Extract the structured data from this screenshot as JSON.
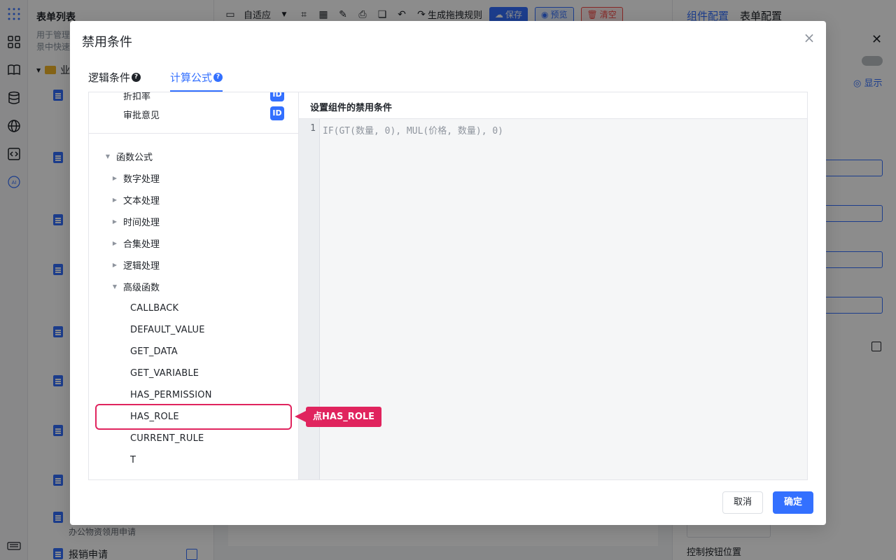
{
  "background": {
    "list_title": "表单列表",
    "list_desc_1": "用于管理",
    "list_desc_2": "景中快速",
    "folder_label": "业",
    "bottom_sub": "办公物资领用申请",
    "bottom_item": "报销申请",
    "toolbar": {
      "adapt_label": "自适应",
      "gen_rule_label": "生成拖拽规则",
      "save_label": "保存",
      "preview_label": "预览",
      "clear_label": "清空"
    },
    "right": {
      "tab_component": "组件配置",
      "tab_form": "表单配置",
      "show_label": "显示",
      "bottom_label": "控制按钮位置"
    }
  },
  "modal": {
    "title": "禁用条件",
    "tabs": [
      {
        "label": "逻辑条件",
        "active": false
      },
      {
        "label": "计算公式",
        "active": true
      }
    ],
    "fields": [
      {
        "label": "折扣率",
        "badge": "ID"
      },
      {
        "label": "审批意见",
        "badge": "ID"
      }
    ],
    "tree": {
      "root": "函数公式",
      "categories": [
        "数字处理",
        "文本处理",
        "时间处理",
        "合集处理",
        "逻辑处理",
        "高级函数"
      ],
      "advanced_functions": [
        "CALLBACK",
        "DEFAULT_VALUE",
        "GET_DATA",
        "GET_VARIABLE",
        "HAS_PERMISSION",
        "HAS_ROLE",
        "CURRENT_RULE",
        "T"
      ]
    },
    "editor": {
      "header": "设置组件的禁用条件",
      "line_number": "1",
      "placeholder": "IF(GT(数量, 0), MUL(价格, 数量), 0)"
    },
    "callout": "点HAS_ROLE",
    "cancel_label": "取消",
    "ok_label": "确定",
    "accent_color": "#3370ff",
    "highlight_color": "#e0245e"
  }
}
